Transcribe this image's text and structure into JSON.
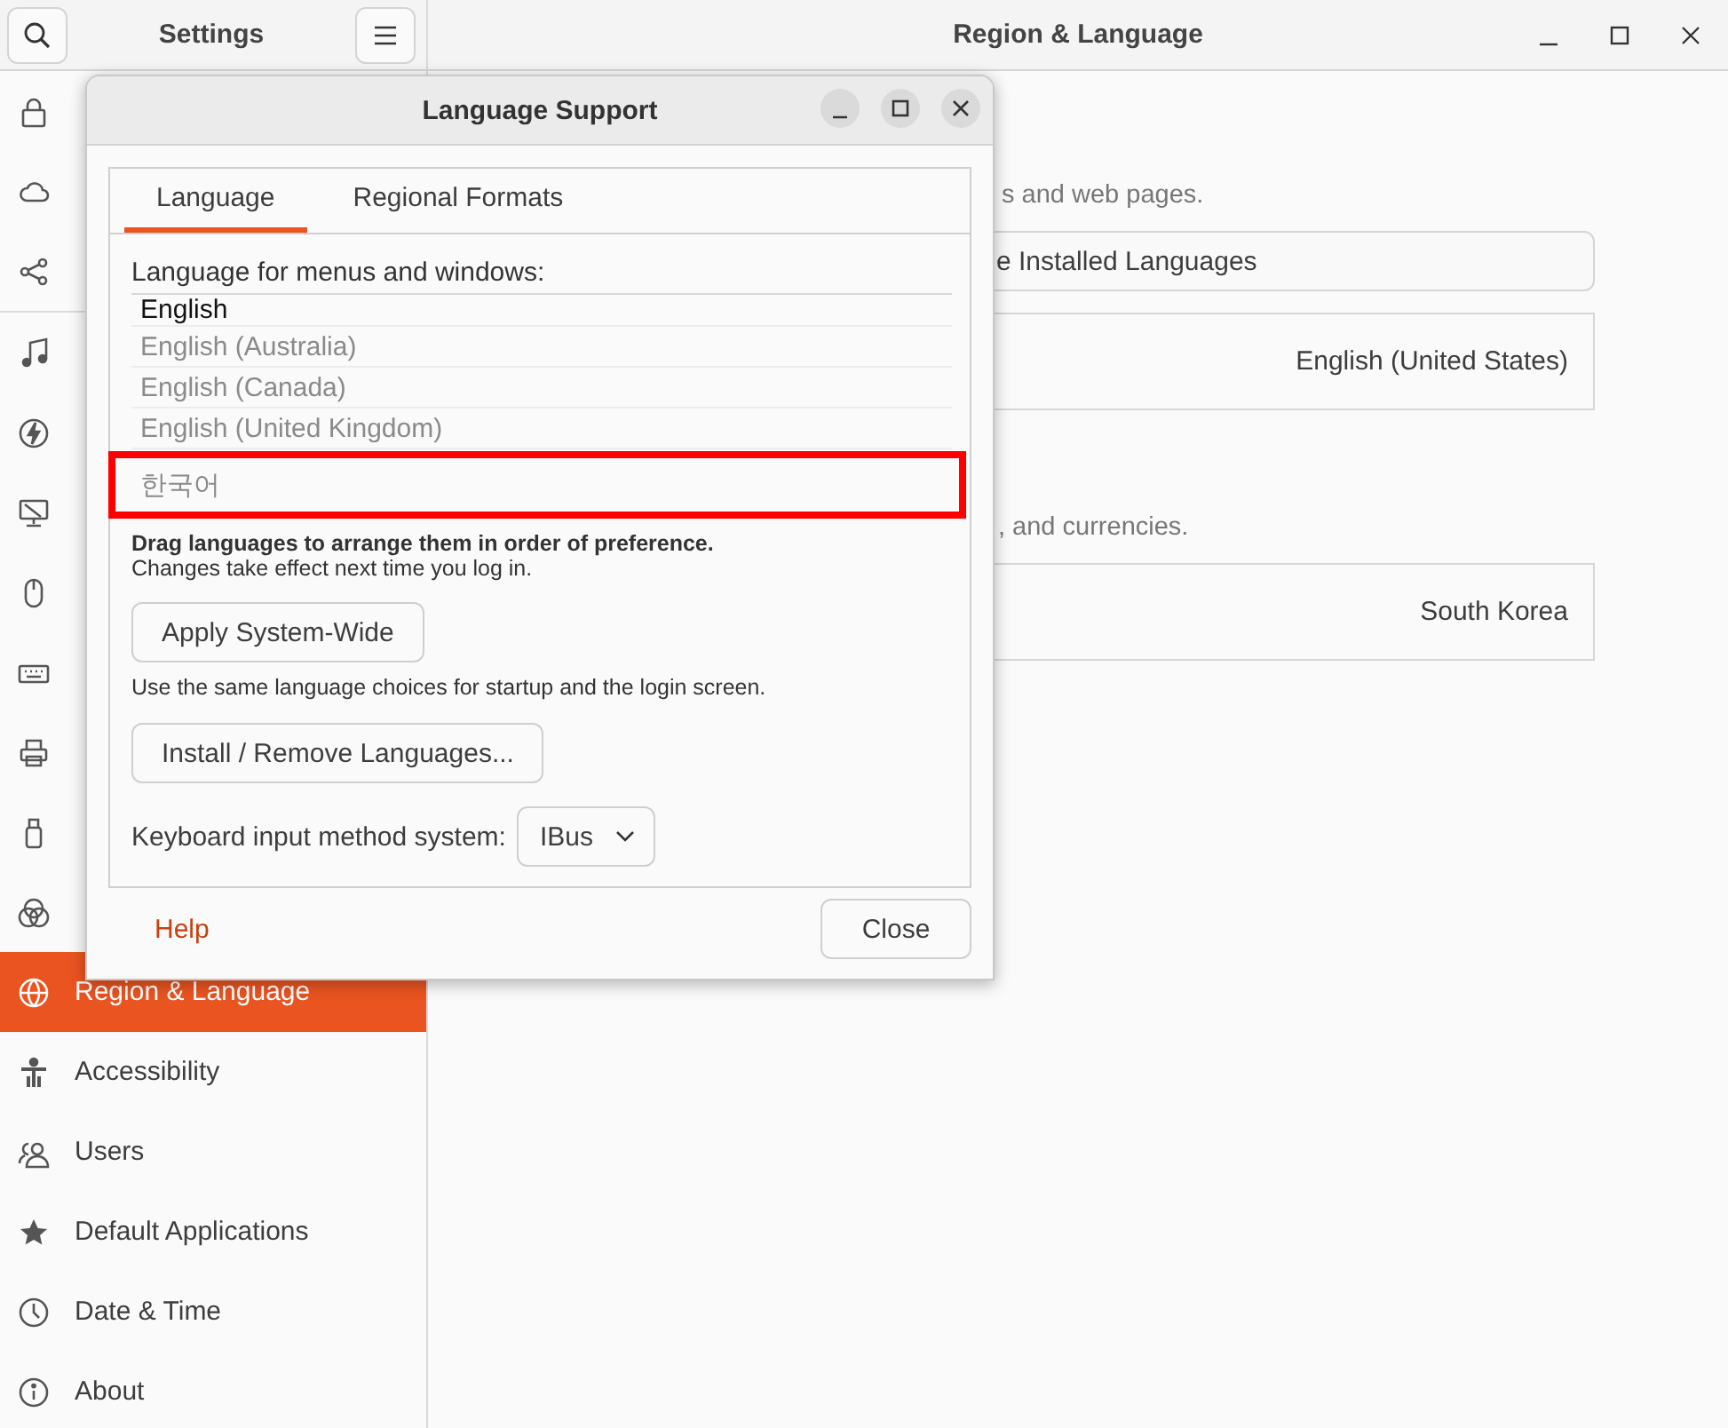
{
  "sidebar": {
    "title": "Settings",
    "groups": [
      [
        {
          "selected": false
        },
        {
          "selected": false
        },
        {
          "selected": false
        }
      ],
      [
        {
          "selected": false
        },
        {
          "selected": false
        },
        {
          "selected": false
        },
        {
          "selected": false
        },
        {
          "selected": false
        },
        {
          "selected": false
        },
        {
          "selected": false
        },
        {
          "selected": false
        },
        {
          "label": "Region & Language",
          "selected": true
        },
        {
          "label": "Accessibility",
          "selected": false
        },
        {
          "label": "Users",
          "selected": false
        },
        {
          "label": "Default Applications",
          "selected": false
        },
        {
          "label": "Date & Time",
          "selected": false
        },
        {
          "label": "About",
          "selected": false
        }
      ]
    ]
  },
  "window": {
    "title": "Region & Language"
  },
  "content": {
    "language_hint": "s and web pages.",
    "manage_button": "e Installed Languages",
    "language_value": "English (United States)",
    "formats_hint": ", and currencies.",
    "formats_value": "South Korea"
  },
  "dialog": {
    "title": "Language Support",
    "tabs": [
      {
        "label": "Language",
        "selected": true
      },
      {
        "label": "Regional Formats",
        "selected": false
      }
    ],
    "list_label": "Language for menus and windows:",
    "languages": [
      {
        "name": "English",
        "dimmed": false,
        "highlighted": false
      },
      {
        "name": "English (Australia)",
        "dimmed": true,
        "highlighted": false
      },
      {
        "name": "English (Canada)",
        "dimmed": true,
        "highlighted": false
      },
      {
        "name": "English (United Kingdom)",
        "dimmed": true,
        "highlighted": false
      },
      {
        "name": "한국어",
        "dimmed": true,
        "highlighted": true
      }
    ],
    "drag_note": "Drag languages to arrange them in order of preference.",
    "effect_note": "Changes take effect next time you log in.",
    "apply_button": "Apply System-Wide",
    "apply_note": "Use the same language choices for startup and the login screen.",
    "install_button": "Install / Remove Languages...",
    "input_label": "Keyboard input method system:",
    "input_value": "IBus",
    "help_link": "Help",
    "close_button": "Close"
  }
}
